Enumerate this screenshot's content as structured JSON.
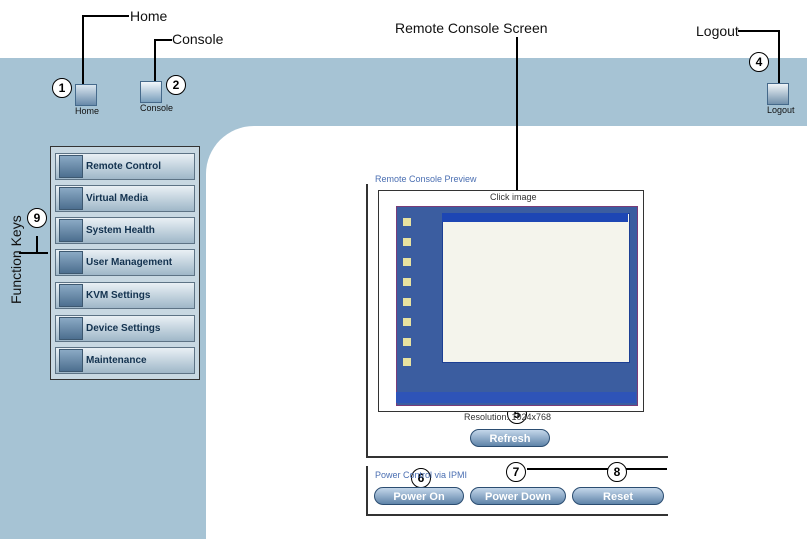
{
  "callouts": {
    "home": "Home",
    "console": "Console",
    "remote_console_screen": "Remote Console Screen",
    "logout": "Logout",
    "function_keys": "Function Keys"
  },
  "numbers": [
    "1",
    "2",
    "3",
    "4",
    "5",
    "6",
    "7",
    "8",
    "9"
  ],
  "toolbar": {
    "home_label": "Home",
    "console_label": "Console",
    "logout_label": "Logout"
  },
  "sidebar": {
    "items": [
      {
        "label": "Remote Control",
        "icon": "monitor-icon"
      },
      {
        "label": "Virtual Media",
        "icon": "disc-icon"
      },
      {
        "label": "System Health",
        "icon": "health-icon"
      },
      {
        "label": "User Management",
        "icon": "users-icon"
      },
      {
        "label": "KVM Settings",
        "icon": "keyboard-icon"
      },
      {
        "label": "Device Settings",
        "icon": "gear-icon"
      },
      {
        "label": "Maintenance",
        "icon": "wrench-icon"
      }
    ]
  },
  "preview": {
    "title": "Remote Console Preview",
    "caption": "Click image",
    "resolution": "Resolution: 1024x768",
    "refresh_label": "Refresh"
  },
  "power": {
    "title": "Power Control via IPMI",
    "power_on_label": "Power On",
    "power_down_label": "Power Down",
    "reset_label": "Reset"
  },
  "colors": {
    "frame": "#a6c3d4",
    "sidebar_text": "#13324f",
    "button": "#5f84a9"
  }
}
